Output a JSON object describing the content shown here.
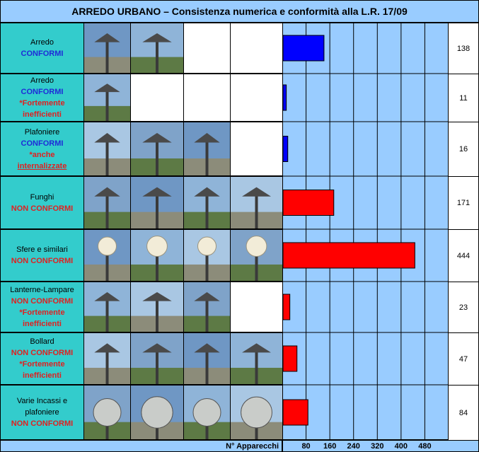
{
  "title": "ARREDO URBANO – Consistenza numerica e conformità alla L.R. 17/09",
  "footer_label": "N° Apparecchi",
  "rows": [
    {
      "name": "Arredo",
      "status": "CONFORMI",
      "note": ""
    },
    {
      "name": "Arredo",
      "status": "CONFORMI",
      "note": "*Fortemente inefficienti"
    },
    {
      "name": "Plafoniere",
      "status": "CONFORMI",
      "note": "*anche",
      "note2": "internalizzate"
    },
    {
      "name": "Funghi",
      "status": "NON CONFORMI",
      "note": ""
    },
    {
      "name": "Sfere e similari",
      "status": "NON CONFORMI",
      "note": ""
    },
    {
      "name": "Lanterne-Lampare",
      "status": "NON CONFORMI",
      "note": "*Fortemente inefficienti"
    },
    {
      "name": "Bollard",
      "status": "NON CONFORMI",
      "note": "*Fortemente inefficienti"
    },
    {
      "name": "Varie Incassi e plafoniere",
      "status": "NON CONFORMI",
      "note": ""
    }
  ],
  "colors": {
    "conformi": "#0000ff",
    "non_conformi": "#ff0000",
    "plot_bg": "#99ccff",
    "label_bg": "#33cccc"
  },
  "chart_data": {
    "type": "bar",
    "orientation": "horizontal",
    "title": "ARREDO URBANO – Consistenza numerica e conformità alla L.R. 17/09",
    "xlabel": "N° Apparecchi",
    "categories": [
      "Arredo CONFORMI",
      "Arredo CONFORMI *Fortemente inefficienti",
      "Plafoniere CONFORMI *anche internalizzate",
      "Funghi NON CONFORMI",
      "Sfere e similari NON CONFORMI",
      "Lanterne-Lampare NON CONFORMI *Fortemente inefficienti",
      "Bollard NON CONFORMI *Fortemente inefficienti",
      "Varie Incassi e plafoniere NON CONFORMI"
    ],
    "values": [
      138,
      11,
      16,
      171,
      444,
      23,
      47,
      84
    ],
    "conformity": [
      "conforme",
      "conforme",
      "conforme",
      "non_conforme",
      "non_conforme",
      "non_conforme",
      "non_conforme",
      "non_conforme"
    ],
    "xticks": [
      80,
      160,
      240,
      320,
      400,
      480
    ],
    "xlim": [
      0,
      560
    ],
    "grid": true
  }
}
